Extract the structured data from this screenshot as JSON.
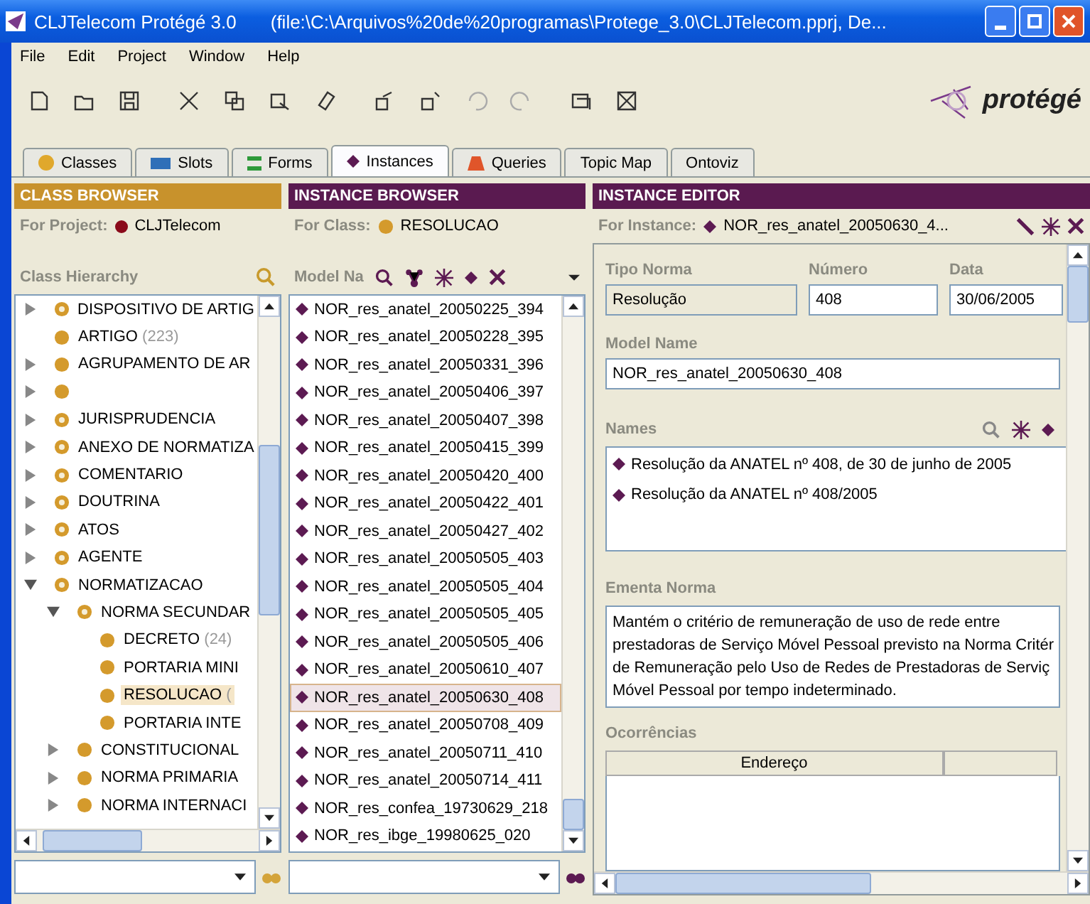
{
  "window": {
    "title": "CLJTelecom  Protégé 3.0",
    "file": "(file:\\C:\\Arquivos%20de%20programas\\Protege_3.0\\CLJTelecom.pprj, De..."
  },
  "menu": [
    "File",
    "Edit",
    "Project",
    "Window",
    "Help"
  ],
  "logo": "protégé",
  "tabs": [
    {
      "label": "Classes",
      "kind": "dot",
      "selected": false
    },
    {
      "label": "Slots",
      "kind": "bar",
      "selected": false
    },
    {
      "label": "Forms",
      "kind": "lines",
      "selected": false
    },
    {
      "label": "Instances",
      "kind": "diamond",
      "selected": true
    },
    {
      "label": "Queries",
      "kind": "triangle",
      "selected": false
    },
    {
      "label": "Topic Map",
      "kind": "none",
      "selected": false
    },
    {
      "label": "Ontoviz",
      "kind": "none",
      "selected": false
    }
  ],
  "class_browser": {
    "title": "CLASS BROWSER",
    "for_label": "For Project:",
    "project": "CLJTelecom",
    "hierarchy_label": "Class Hierarchy",
    "tree": [
      {
        "label": "DISPOSITIVO DE ARTIG",
        "abstract": true,
        "expanded": false,
        "selected": false
      },
      {
        "label": "ARTIGO",
        "count": "(223)",
        "abstract": false,
        "selected": false
      },
      {
        "label": "AGRUPAMENTO DE AR",
        "abstract": false,
        "expanded": false,
        "selected": false
      },
      {
        "abstract": false,
        "expanded": false,
        "selected": false
      },
      {
        "label": "JURISPRUDENCIA",
        "abstract": true,
        "expanded": false,
        "selected": false
      },
      {
        "label": "ANEXO DE NORMATIZA",
        "abstract": true,
        "expanded": false,
        "selected": false
      },
      {
        "label": "COMENTARIO",
        "abstract": true,
        "expanded": false,
        "selected": false
      },
      {
        "label": "DOUTRINA",
        "abstract": true,
        "expanded": false,
        "selected": false
      },
      {
        "label": "ATOS",
        "abstract": true,
        "expanded": false,
        "selected": false
      },
      {
        "label": "AGENTE",
        "abstract": true,
        "expanded": false,
        "selected": false
      },
      {
        "label": "NORMATIZACAO",
        "abstract": true,
        "expanded": true,
        "selected": false,
        "children": [
          {
            "label": "NORMA SECUNDAR",
            "abstract": true,
            "expanded": true,
            "selected": false,
            "children": [
              {
                "label": "DECRETO",
                "count": "(24)",
                "abstract": false,
                "selected": false
              },
              {
                "label": "PORTARIA MINI",
                "abstract": false,
                "selected": false
              },
              {
                "label": "RESOLUCAO",
                "count": "(",
                "abstract": false,
                "selected": true
              },
              {
                "label": "PORTARIA INTE",
                "abstract": false,
                "selected": false
              }
            ]
          },
          {
            "label": "CONSTITUCIONAL",
            "abstract": false,
            "expanded": false,
            "selected": false
          },
          {
            "label": "NORMA PRIMARIA",
            "abstract": false,
            "expanded": false,
            "selected": false
          },
          {
            "label": "NORMA INTERNACI",
            "abstract": false,
            "expanded": false,
            "selected": false
          }
        ]
      }
    ]
  },
  "instance_browser": {
    "title": "INSTANCE BROWSER",
    "for_label": "For Class:",
    "class": "RESOLUCAO",
    "list_label": "Model Na",
    "instances": [
      {
        "name": "NOR_res_anatel_20050225_394",
        "selected": false
      },
      {
        "name": "NOR_res_anatel_20050228_395",
        "selected": false
      },
      {
        "name": "NOR_res_anatel_20050331_396",
        "selected": false
      },
      {
        "name": "NOR_res_anatel_20050406_397",
        "selected": false
      },
      {
        "name": "NOR_res_anatel_20050407_398",
        "selected": false
      },
      {
        "name": "NOR_res_anatel_20050415_399",
        "selected": false
      },
      {
        "name": "NOR_res_anatel_20050420_400",
        "selected": false
      },
      {
        "name": "NOR_res_anatel_20050422_401",
        "selected": false
      },
      {
        "name": "NOR_res_anatel_20050427_402",
        "selected": false
      },
      {
        "name": "NOR_res_anatel_20050505_403",
        "selected": false
      },
      {
        "name": "NOR_res_anatel_20050505_404",
        "selected": false
      },
      {
        "name": "NOR_res_anatel_20050505_405",
        "selected": false
      },
      {
        "name": "NOR_res_anatel_20050505_406",
        "selected": false
      },
      {
        "name": "NOR_res_anatel_20050610_407",
        "selected": false
      },
      {
        "name": "NOR_res_anatel_20050630_408",
        "selected": true
      },
      {
        "name": "NOR_res_anatel_20050708_409",
        "selected": false
      },
      {
        "name": "NOR_res_anatel_20050711_410",
        "selected": false
      },
      {
        "name": "NOR_res_anatel_20050714_411",
        "selected": false
      },
      {
        "name": "NOR_res_confea_19730629_218",
        "selected": false
      },
      {
        "name": "NOR_res_ibge_19980625_020",
        "selected": false
      }
    ]
  },
  "instance_editor": {
    "title": "INSTANCE EDITOR",
    "for_label": "For Instance:",
    "instance": "NOR_res_anatel_20050630_4...",
    "fields": [
      {
        "label": "Tipo Norma",
        "value": "Resolução",
        "editable": false
      },
      {
        "label": "Número",
        "value": "408",
        "editable": true
      },
      {
        "label": "Data",
        "value": "30/06/2005",
        "editable": true
      }
    ],
    "model_name": {
      "label": "Model Name",
      "value": "NOR_res_anatel_20050630_408"
    },
    "names": {
      "label": "Names",
      "items": [
        "Resolução da ANATEL nº 408, de 30 de junho de 2005",
        "Resolução da ANATEL nº 408/2005"
      ]
    },
    "ementa": {
      "label": "Ementa Norma",
      "lines": [
        "Mantém o critério de remuneração de uso de rede entre",
        "prestadoras de Serviço Móvel Pessoal previsto na Norma Critér",
        "de Remuneração pelo Uso de Redes de Prestadoras de Serviç",
        "Móvel Pessoal por tempo indeterminado."
      ]
    },
    "ocorrencias": {
      "label": "Ocorrências",
      "columns": [
        "Endereço"
      ]
    }
  }
}
